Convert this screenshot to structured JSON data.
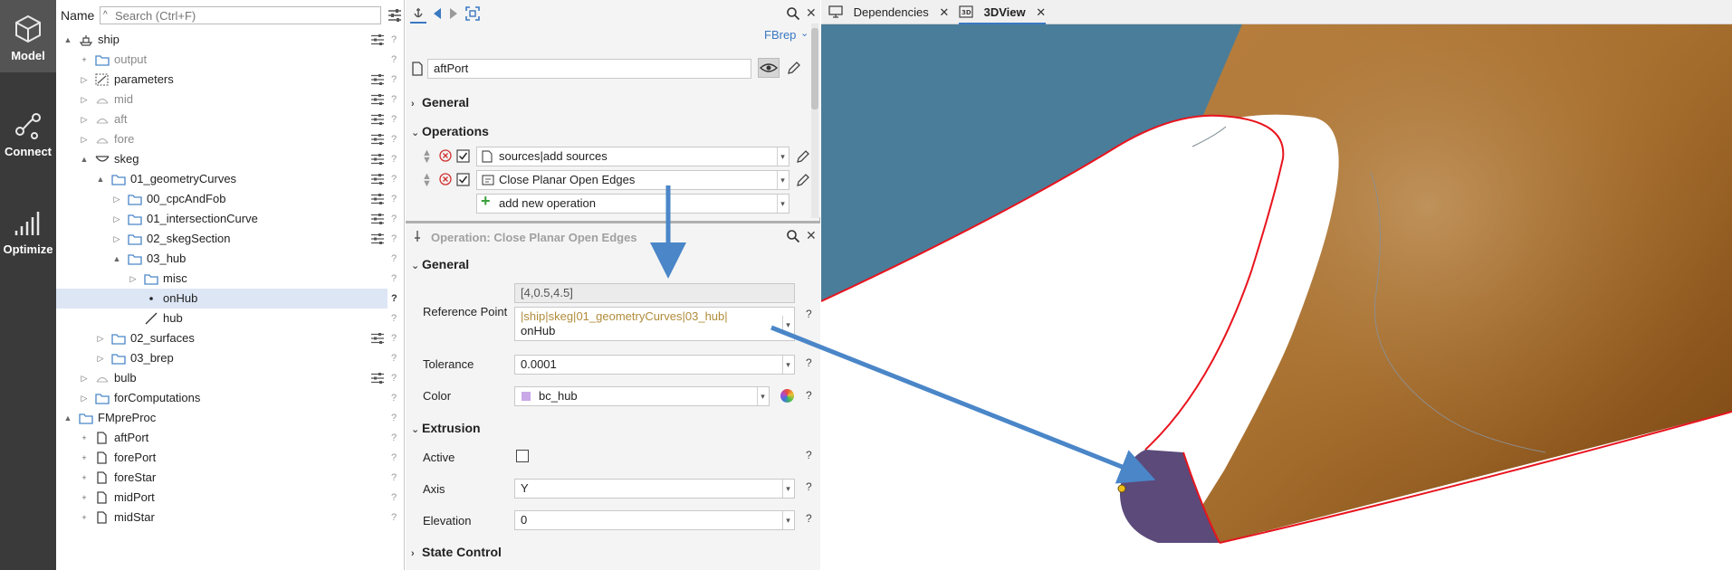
{
  "nav": {
    "items": [
      {
        "label": "Model",
        "active": true
      },
      {
        "label": "Connect",
        "active": false
      },
      {
        "label": "Optimize",
        "active": false
      }
    ]
  },
  "tree": {
    "name_label": "Name",
    "search_placeholder": "Search (Ctrl+F)",
    "rows": [
      {
        "label": "ship",
        "depth": 0,
        "expander": "▲",
        "icon": "ship-icon",
        "tune": true,
        "q": "?",
        "gray": false
      },
      {
        "label": "output",
        "depth": 1,
        "expander": "+",
        "icon": "folder-icon",
        "tune": false,
        "q": "?",
        "gray": true
      },
      {
        "label": "parameters",
        "depth": 1,
        "expander": "▷",
        "icon": "parameters-icon",
        "tune": true,
        "q": "?",
        "gray": false
      },
      {
        "label": "mid",
        "depth": 1,
        "expander": "▷",
        "icon": "section-icon",
        "tune": true,
        "q": "?",
        "gray": true
      },
      {
        "label": "aft",
        "depth": 1,
        "expander": "▷",
        "icon": "section-icon",
        "tune": true,
        "q": "?",
        "gray": true
      },
      {
        "label": "fore",
        "depth": 1,
        "expander": "▷",
        "icon": "section-icon",
        "tune": true,
        "q": "?",
        "gray": true
      },
      {
        "label": "skeg",
        "depth": 1,
        "expander": "▲",
        "icon": "skeg-icon",
        "tune": true,
        "q": "?",
        "gray": false
      },
      {
        "label": "01_geometryCurves",
        "depth": 2,
        "expander": "▲",
        "icon": "folder-icon",
        "tune": true,
        "q": "?",
        "gray": false
      },
      {
        "label": "00_cpcAndFob",
        "depth": 3,
        "expander": "▷",
        "icon": "folder-icon",
        "tune": true,
        "q": "?",
        "gray": false
      },
      {
        "label": "01_intersectionCurve",
        "depth": 3,
        "expander": "▷",
        "icon": "folder-icon",
        "tune": true,
        "q": "?",
        "gray": false
      },
      {
        "label": "02_skegSection",
        "depth": 3,
        "expander": "▷",
        "icon": "folder-icon",
        "tune": true,
        "q": "?",
        "gray": false
      },
      {
        "label": "03_hub",
        "depth": 3,
        "expander": "▲",
        "icon": "folder-icon",
        "tune": false,
        "q": "?",
        "gray": false
      },
      {
        "label": "misc",
        "depth": 4,
        "expander": "▷",
        "icon": "folder-icon",
        "tune": false,
        "q": "?",
        "gray": false
      },
      {
        "label": "onHub",
        "depth": 4,
        "expander": "",
        "icon": "point-icon",
        "tune": false,
        "q": "?",
        "gray": false,
        "selected": true
      },
      {
        "label": "hub",
        "depth": 4,
        "expander": "",
        "icon": "curve-icon",
        "tune": false,
        "q": "?",
        "gray": false
      },
      {
        "label": "02_surfaces",
        "depth": 2,
        "expander": "▷",
        "icon": "folder-icon",
        "tune": true,
        "q": "?",
        "gray": false
      },
      {
        "label": "03_brep",
        "depth": 2,
        "expander": "▷",
        "icon": "folder-icon",
        "tune": false,
        "q": "?",
        "gray": false
      },
      {
        "label": "bulb",
        "depth": 1,
        "expander": "▷",
        "icon": "section-icon",
        "tune": true,
        "q": "?",
        "gray": false
      },
      {
        "label": "forComputations",
        "depth": 1,
        "expander": "▷",
        "icon": "folder-icon",
        "tune": false,
        "q": "?",
        "gray": false
      },
      {
        "label": "FMpreProc",
        "depth": 0,
        "expander": "▲",
        "icon": "folder-icon",
        "tune": false,
        "q": "?",
        "gray": false
      },
      {
        "label": "aftPort",
        "depth": 1,
        "expander": "+",
        "icon": "document-icon",
        "tune": false,
        "q": "?",
        "gray": false
      },
      {
        "label": "forePort",
        "depth": 1,
        "expander": "+",
        "icon": "document-icon",
        "tune": false,
        "q": "?",
        "gray": false
      },
      {
        "label": "foreStar",
        "depth": 1,
        "expander": "+",
        "icon": "document-icon",
        "tune": false,
        "q": "?",
        "gray": false
      },
      {
        "label": "midPort",
        "depth": 1,
        "expander": "+",
        "icon": "document-icon",
        "tune": false,
        "q": "?",
        "gray": false
      },
      {
        "label": "midStar",
        "depth": 1,
        "expander": "+",
        "icon": "document-icon",
        "tune": false,
        "q": "?",
        "gray": false
      }
    ]
  },
  "props": {
    "type_label": "FBrep",
    "object_name": "aftPort",
    "general_label": "General",
    "operations_label": "Operations",
    "operations": [
      {
        "label": "sources|add sources"
      },
      {
        "label": "Close Planar Open Edges"
      }
    ],
    "add_operation_label": "add new operation",
    "op_panel_title": "Operation: Close Planar Open Edges",
    "op_general_label": "General",
    "ref_point_value": "[4,0.5,4.5]",
    "ref_point_label": "Reference Point",
    "ref_point_path": "|ship|skeg|01_geometryCurves|03_hub|",
    "ref_point_name": "onHub",
    "tolerance_label": "Tolerance",
    "tolerance_value": "0.0001",
    "color_label": "Color",
    "color_value": "bc_hub",
    "color_swatch": "#c9a8e8",
    "extrusion_label": "Extrusion",
    "active_label": "Active",
    "axis_label": "Axis",
    "axis_value": "Y",
    "elevation_label": "Elevation",
    "elevation_value": "0",
    "state_control_label": "State Control",
    "qmark": "?"
  },
  "view": {
    "tabs": [
      {
        "label": "Dependencies",
        "icon": "monitor-icon",
        "active": false
      },
      {
        "label": "3DView",
        "icon": "3d-icon",
        "active": true
      }
    ],
    "colors": {
      "hull_blue": "#4a7d99",
      "hub_brown": "#a2692a",
      "cap_purple": "#5b4a7a",
      "edge_red": "#e8141e",
      "arrow_blue": "#4a86c8"
    }
  }
}
